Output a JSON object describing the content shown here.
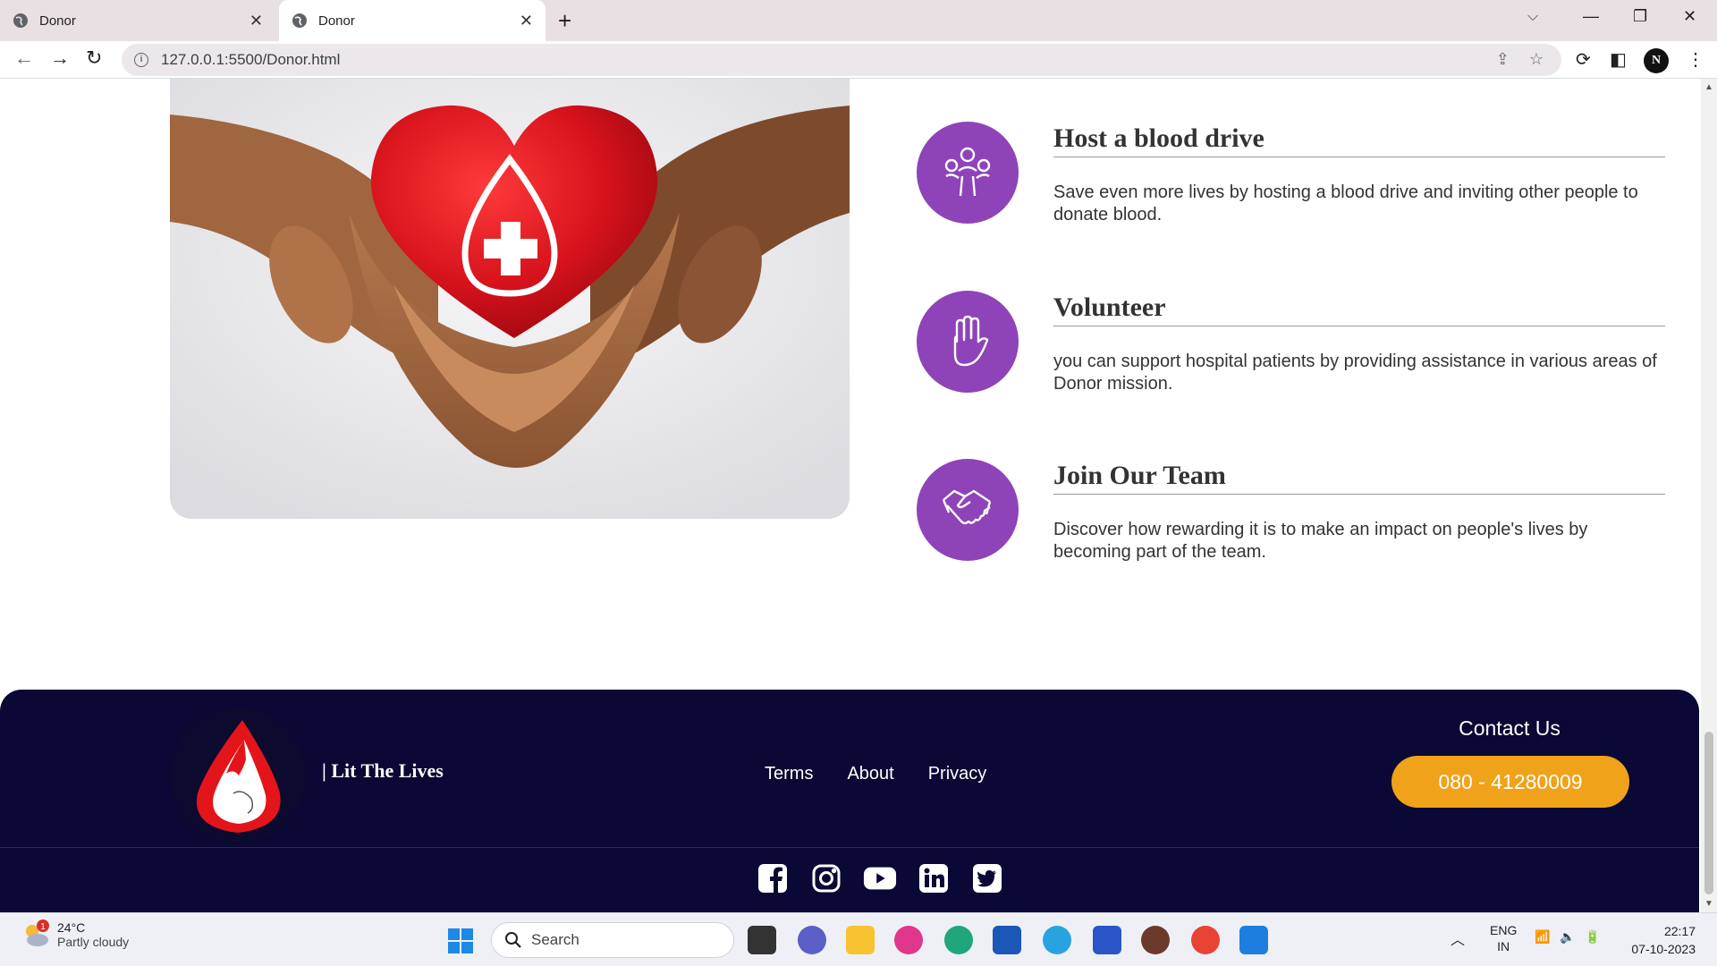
{
  "browser": {
    "tabs": [
      {
        "title": "Donor",
        "active": false
      },
      {
        "title": "Donor",
        "active": true
      }
    ],
    "url": "127.0.0.1:5500/Donor.html",
    "profile_initial": "N"
  },
  "features": [
    {
      "icon": "people-icon",
      "title": "Host a blood drive",
      "description": "Save even more lives by hosting a blood drive and inviting other people to donate blood."
    },
    {
      "icon": "hand-icon",
      "title": "Volunteer",
      "description": "you can support hospital patients by providing assistance in various areas of Donor mission."
    },
    {
      "icon": "handshake-icon",
      "title": "Join Our Team",
      "description": "Discover how rewarding it is to make an impact on people's lives by becoming part of the team."
    }
  ],
  "footer": {
    "brand": "| Lit The Lives",
    "links": [
      "Terms",
      "About",
      "Privacy"
    ],
    "contact_title": "Contact Us",
    "phone": "080 - 41280009",
    "socials": [
      "facebook-icon",
      "instagram-icon",
      "youtube-icon",
      "linkedin-icon",
      "twitter-icon"
    ]
  },
  "taskbar": {
    "weather": {
      "temp": "24°C",
      "condition": "Partly cloudy",
      "badge": "1"
    },
    "search_label": "Search",
    "lang": "ENG",
    "region": "IN",
    "time": "22:17",
    "date": "07-10-2023"
  },
  "colors": {
    "accent_purple": "#8e44b8",
    "footer_bg": "#0a0834",
    "phone_button": "#f0a21a",
    "heart_red": "#d6121c"
  }
}
